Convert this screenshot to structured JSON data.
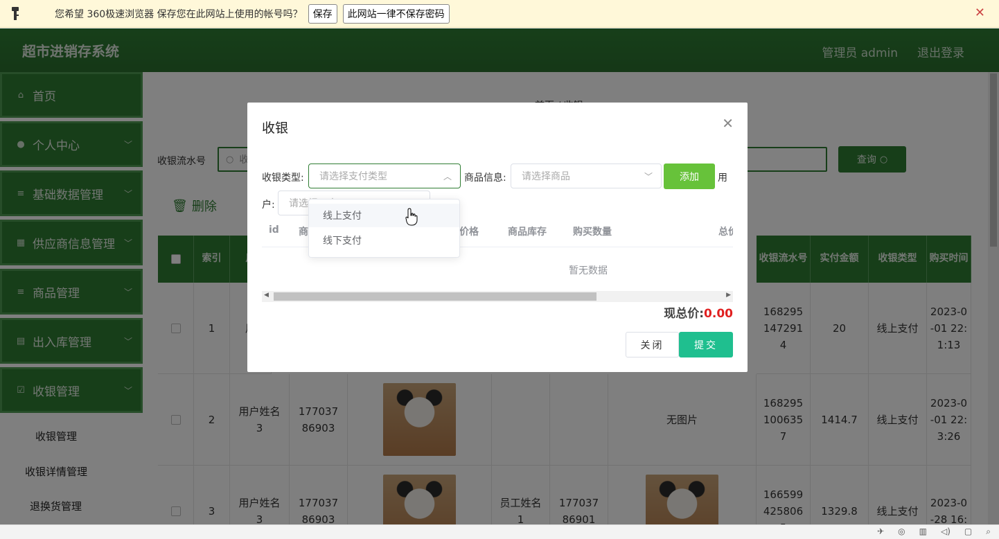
{
  "browser_bar": {
    "message": "您希望 360极速浏览器 保存您在此网站上使用的帐号吗？",
    "save_label": "保存",
    "never_label": "此网站一律不保存密码",
    "close_glyph": "✕"
  },
  "header": {
    "brand": "超市进销存系统",
    "user": "管理员 admin",
    "logout": "退出登录"
  },
  "sidebar": {
    "items": [
      {
        "label": "首页",
        "icon": "home-icon",
        "glyph": "⌂"
      },
      {
        "label": "个人中心",
        "icon": "person-icon",
        "glyph": "●"
      },
      {
        "label": "基础数据管理",
        "icon": "list-icon",
        "glyph": "≡"
      },
      {
        "label": "供应商信息管理",
        "icon": "grid-icon",
        "glyph": "▦"
      },
      {
        "label": "商品管理",
        "icon": "list-icon",
        "glyph": "≡"
      },
      {
        "label": "出入库管理",
        "icon": "clipboard-icon",
        "glyph": "▤"
      },
      {
        "label": "收银管理",
        "icon": "checkbox-icon",
        "glyph": "☑"
      }
    ],
    "subitems": [
      "收银管理",
      "收银详情管理",
      "退换货管理"
    ]
  },
  "main": {
    "breadcrumb": "首页 / 收银",
    "search_label": "收银流水号",
    "search_placeholder": "收",
    "query_label": "查询",
    "delete_label": "删除"
  },
  "table": {
    "headers": {
      "index": "索引",
      "user": "用",
      "serial": "收银流水号",
      "paid": "实付金额",
      "type": "收银类型",
      "time": "购买时间"
    },
    "rows": [
      {
        "index": "1",
        "user": "用",
        "serial": "1682951472914",
        "paid": "20",
        "type": "线上支付",
        "time": "2023-0-01 22:1:13"
      },
      {
        "index": "2",
        "user": "用户姓名3",
        "phone": "17703786903",
        "noimg": "无图片",
        "serial": "1682951006357",
        "paid": "1414.7",
        "type": "线上支付",
        "time": "2023-0-01 22:3:26"
      },
      {
        "index": "3",
        "user": "用户姓名3",
        "phone": "17703786903",
        "staff": "员工姓名1",
        "staff_phone": "17703786901",
        "serial": "1665994258065",
        "paid": "1329.8",
        "type": "线上支付",
        "time": "2023-0-28 16:"
      }
    ]
  },
  "modal": {
    "title": "收银",
    "pay_type_label": "收银类型:",
    "pay_type_placeholder": "请选择支付类型",
    "goods_label": "商品信息:",
    "goods_placeholder": "请选择商品",
    "add_label": "添加",
    "user_label_a": "用",
    "user_label_b": "户:",
    "user_placeholder": "请选择用户",
    "columns": [
      "id",
      "商",
      "总价格",
      "商品库存",
      "购买数量",
      "总价"
    ],
    "empty_text": "暂无数据",
    "total_label": "现总价:",
    "total_value": "0.00",
    "close_label": "关闭",
    "submit_label": "提交"
  },
  "dropdown": {
    "options": [
      "线上支付",
      "线下支付"
    ]
  },
  "colors": {
    "primary": "#2f7d33",
    "add": "#67c23a",
    "submit": "#1fbf8f",
    "total": "#e02020"
  }
}
